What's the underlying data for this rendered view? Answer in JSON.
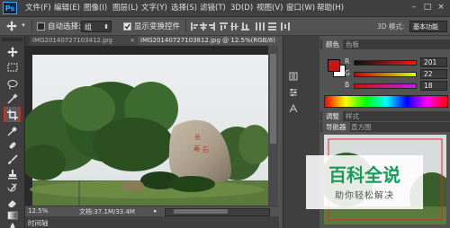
{
  "app": {
    "logo": "Ps"
  },
  "menu": {
    "items": [
      "文件(F)",
      "编辑(E)",
      "图像(I)",
      "图层(L)",
      "文字(Y)",
      "选择(S)",
      "滤镜(T)",
      "3D(D)",
      "视图(V)",
      "窗口(W)",
      "帮助(H)"
    ],
    "minimize_icon": "–",
    "maximize_icon": "□",
    "close_icon": "×"
  },
  "options": {
    "auto_select_label": "自动选择:",
    "auto_select_value": "组",
    "show_transform_label": "显示变换控件",
    "mode_3d_label": "3D 模式:",
    "workspace": "基本功能"
  },
  "tabs": [
    {
      "label": "IMG20140727103412.jpg",
      "close": "×"
    },
    {
      "label": "IMG20140727103812.jpg @ 12.5%(RGB/8)",
      "close": "×"
    }
  ],
  "status": {
    "zoom": "12.5%",
    "doc": "文档:37.1M/33.4M"
  },
  "timeline": {
    "label": "时间轴"
  },
  "color_panel": {
    "tabs": [
      "颜色",
      "色板"
    ],
    "channels": [
      {
        "label": "R",
        "value": "201"
      },
      {
        "label": "G",
        "value": "22"
      },
      {
        "label": "B",
        "value": "18"
      }
    ],
    "foreground": "#c91612",
    "background": "#ffffff"
  },
  "adjust_panel": {
    "tabs": [
      "调整",
      "样式"
    ]
  },
  "navigator_panel": {
    "tabs": [
      "导航器",
      "直方图"
    ]
  },
  "watermark": {
    "title": "百科全说",
    "subtitle": "助你轻松解决"
  },
  "icons": {
    "move": "move-icon",
    "marquee": "marquee-icon",
    "lasso": "lasso-icon",
    "wand": "magic-wand-icon",
    "crop": "crop-icon",
    "eyedropper": "eyedropper-icon",
    "heal": "healing-brush-icon",
    "brush": "brush-icon",
    "stamp": "clone-stamp-icon",
    "history": "history-brush-icon",
    "eraser": "eraser-icon",
    "gradient": "gradient-icon",
    "blur": "blur-icon"
  }
}
